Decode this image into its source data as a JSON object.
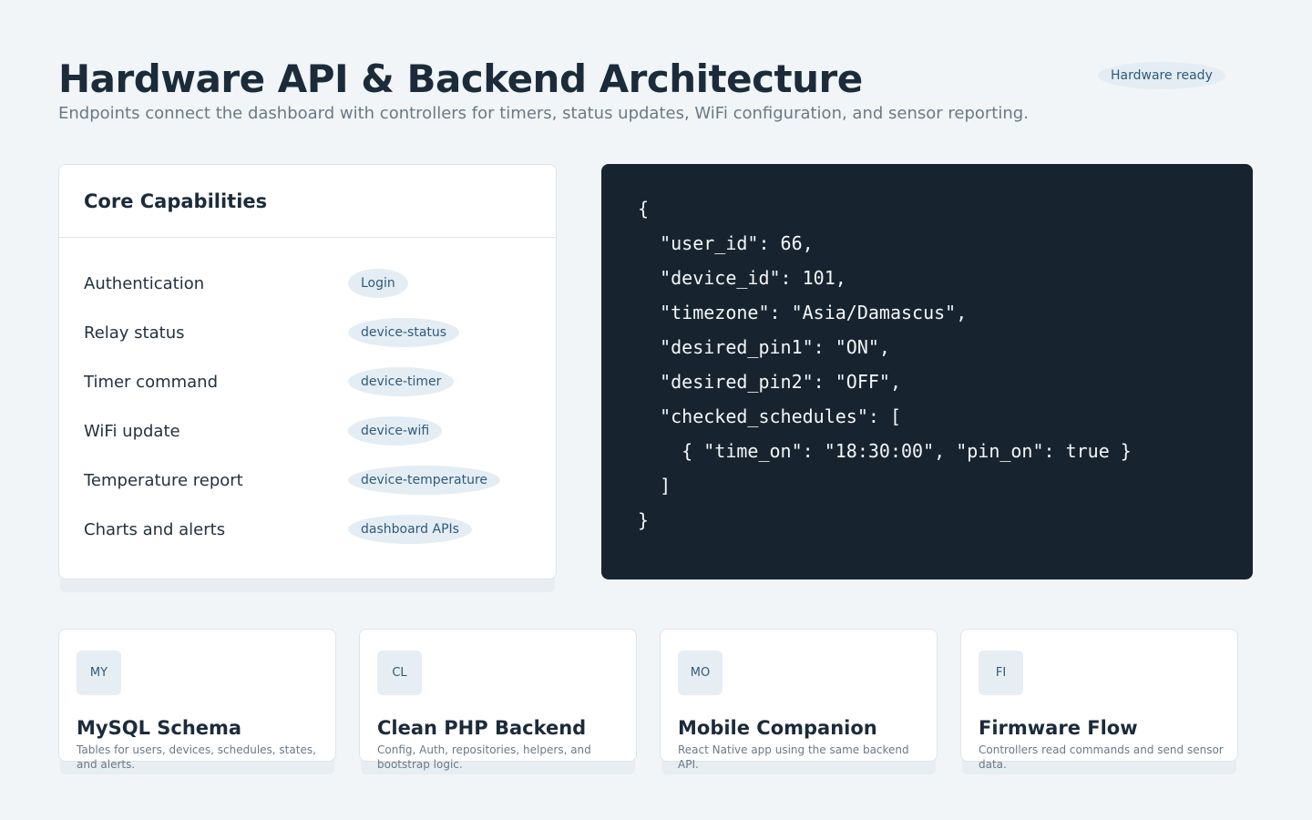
{
  "header": {
    "title": "Hardware API & Backend Architecture",
    "subtitle": "Endpoints connect the dashboard with controllers for timers, status updates, WiFi configuration, and sensor reporting.",
    "status": "Hardware ready"
  },
  "capabilities": {
    "title": "Core Capabilities",
    "items": [
      {
        "label": "Authentication",
        "endpoint": "Login"
      },
      {
        "label": "Relay status",
        "endpoint": "device-status"
      },
      {
        "label": "Timer command",
        "endpoint": "device-timer"
      },
      {
        "label": "WiFi update",
        "endpoint": "device-wifi"
      },
      {
        "label": "Temperature report",
        "endpoint": "device-temperature"
      },
      {
        "label": "Charts and alerts",
        "endpoint": "dashboard APIs"
      }
    ]
  },
  "code": {
    "lines": [
      "{",
      "  \"user_id\": 66,",
      "  \"device_id\": 101,",
      "  \"timezone\": \"Asia/Damascus\",",
      "  \"desired_pin1\": \"ON\",",
      "  \"desired_pin2\": \"OFF\",",
      "  \"checked_schedules\": [",
      "    { \"time_on\": \"18:30:00\", \"pin_on\": true }",
      "  ]",
      "}"
    ]
  },
  "features": [
    {
      "badge": "MY",
      "title": "MySQL Schema",
      "desc": "Tables for users, devices, schedules, states, and alerts."
    },
    {
      "badge": "CL",
      "title": "Clean PHP Backend",
      "desc": "Config, Auth, repositories, helpers, and bootstrap logic."
    },
    {
      "badge": "MO",
      "title": "Mobile Companion",
      "desc": "React Native app using the same backend API."
    },
    {
      "badge": "FI",
      "title": "Firmware Flow",
      "desc": "Controllers read commands and send sensor data."
    }
  ]
}
